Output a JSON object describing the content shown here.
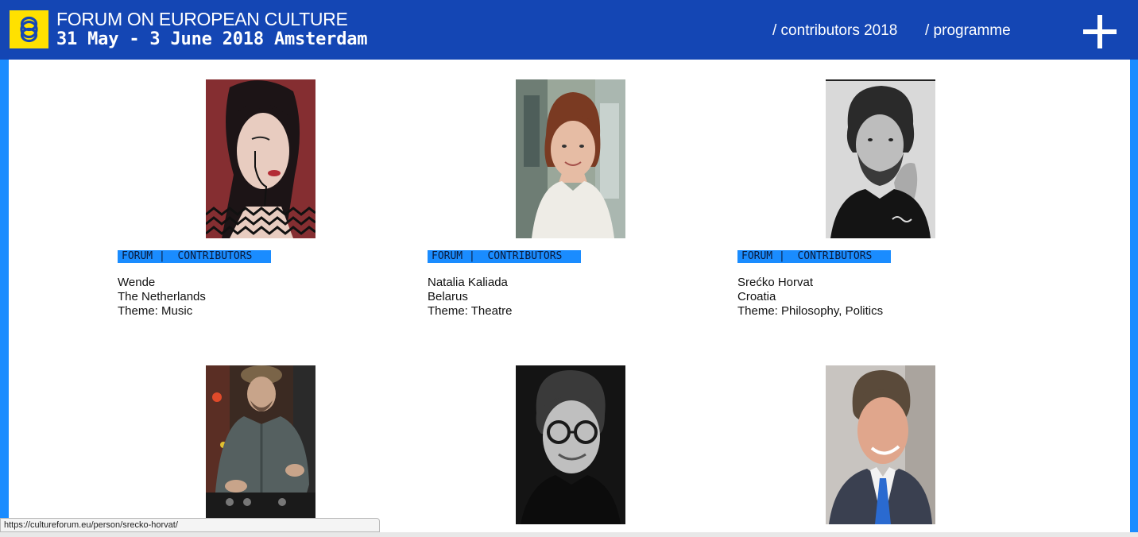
{
  "header": {
    "title_line1": "FORUM ON EUROPEAN CULTURE",
    "title_line2": "31 May - 3 June 2018 Amsterdam",
    "nav": [
      {
        "label": "/ contributors 2018"
      },
      {
        "label": "/ programme"
      }
    ],
    "logo_icon": "linked-rings-logo",
    "menu_icon": "plus-icon"
  },
  "colors": {
    "header_bg": "#1446b4",
    "accent_blue": "#1a8cff",
    "logo_yellow": "#ffe100"
  },
  "contributors": [
    {
      "tag": "FORUM |  CONTRIBUTORS",
      "name": "Wende",
      "country": "The Netherlands",
      "theme": "Theme: Music"
    },
    {
      "tag": "FORUM |  CONTRIBUTORS",
      "name": "Natalia Kaliada",
      "country": "Belarus",
      "theme": "Theme: Theatre"
    },
    {
      "tag": "FORUM |  CONTRIBUTORS",
      "name": "Srećko Horvat",
      "country": "Croatia",
      "theme": "Theme: Philosophy, Politics"
    },
    {
      "photo": "dj-portrait"
    },
    {
      "photo": "glasses-portrait"
    },
    {
      "photo": "suit-portrait"
    }
  ],
  "statusbar": {
    "url": "https://cultureforum.eu/person/srecko-horvat/"
  }
}
